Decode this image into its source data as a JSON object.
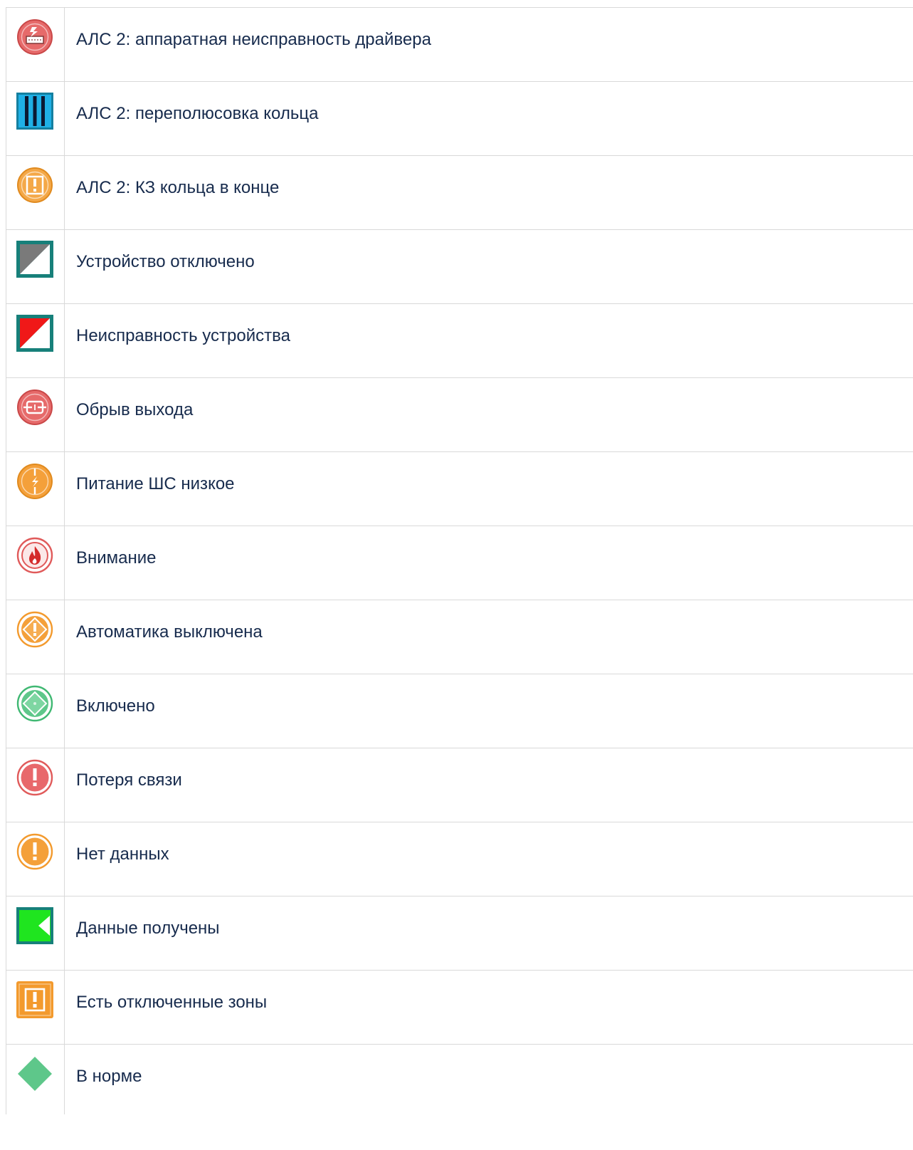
{
  "rows": [
    {
      "icon": "driver-hardware-fault-icon",
      "label": "АЛС 2: аппаратная неисправность драйвера"
    },
    {
      "icon": "ring-polarity-reversal-icon",
      "label": "АЛС 2: переполюсовка кольца"
    },
    {
      "icon": "ring-end-short-circuit-icon",
      "label": "АЛС 2: КЗ кольца в конце"
    },
    {
      "icon": "device-disabled-icon",
      "label": "Устройство отключено"
    },
    {
      "icon": "device-fault-icon",
      "label": "Неисправность устройства"
    },
    {
      "icon": "output-break-icon",
      "label": "Обрыв выхода"
    },
    {
      "icon": "low-power-icon",
      "label": "Питание ШС низкое"
    },
    {
      "icon": "fire-attention-icon",
      "label": "Внимание"
    },
    {
      "icon": "automation-off-icon",
      "label": "Автоматика выключена"
    },
    {
      "icon": "enabled-icon",
      "label": "Включено"
    },
    {
      "icon": "connection-lost-icon",
      "label": "Потеря связи"
    },
    {
      "icon": "no-data-icon",
      "label": "Нет данных"
    },
    {
      "icon": "data-received-icon",
      "label": "Данные получены"
    },
    {
      "icon": "disabled-zones-icon",
      "label": "Есть отключенные зоны"
    },
    {
      "icon": "normal-icon",
      "label": "В норме"
    }
  ],
  "colors": {
    "text": "#172b4d",
    "border": "#d9d9d9",
    "red": "#e05a5a",
    "orange": "#f39a2d",
    "green": "#5ec78a",
    "teal_frame": "#17807a",
    "blue": "#1aa6e0",
    "bright_green": "#1fe51f"
  }
}
